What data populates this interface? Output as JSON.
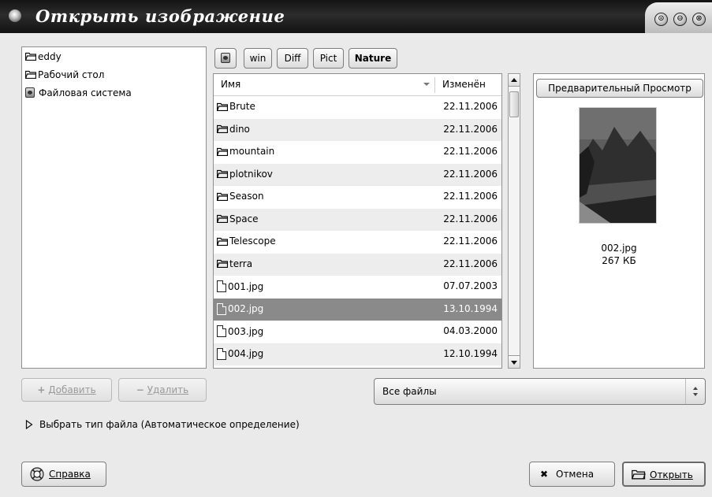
{
  "window": {
    "title": "Открыть изображение",
    "controls": [
      "⊙",
      "⊖",
      "⊗"
    ]
  },
  "places": {
    "items": [
      {
        "label": "eddy",
        "icon": "folder-icon"
      },
      {
        "label": "Рабочий стол",
        "icon": "folder-icon"
      },
      {
        "label": "Файловая система",
        "icon": "drive-icon"
      }
    ],
    "add_label": "Добавить",
    "remove_label": "Удалить"
  },
  "path_bar": {
    "segments": [
      "win",
      "Diff",
      "Pict",
      "Nature"
    ],
    "current": "Nature"
  },
  "file_list": {
    "col_name": "Имя",
    "col_modified": "Изменён",
    "rows": [
      {
        "name": "Brute",
        "date": "22.11.2006",
        "type": "folder"
      },
      {
        "name": "dino",
        "date": "22.11.2006",
        "type": "folder"
      },
      {
        "name": "mountain",
        "date": "22.11.2006",
        "type": "folder"
      },
      {
        "name": "plotnikov",
        "date": "22.11.2006",
        "type": "folder"
      },
      {
        "name": "Season",
        "date": "22.11.2006",
        "type": "folder"
      },
      {
        "name": "Space",
        "date": "22.11.2006",
        "type": "folder"
      },
      {
        "name": "Telescope",
        "date": "22.11.2006",
        "type": "folder"
      },
      {
        "name": "terra",
        "date": "22.11.2006",
        "type": "folder"
      },
      {
        "name": "001.jpg",
        "date": "07.07.2003",
        "type": "file"
      },
      {
        "name": "002.jpg",
        "date": "13.10.1994",
        "type": "file",
        "selected": true
      },
      {
        "name": "003.jpg",
        "date": "04.03.2000",
        "type": "file"
      },
      {
        "name": "004.jpg",
        "date": "12.10.1994",
        "type": "file"
      }
    ]
  },
  "preview": {
    "header": "Предварительный Просмотр",
    "file_name": "002.jpg",
    "file_size": "267 КБ"
  },
  "filter": {
    "selected": "Все файлы"
  },
  "file_type_expander": {
    "label": "Выбрать тип файла (Автоматическое определение)"
  },
  "buttons": {
    "help_label": "Справка",
    "cancel_label": "Отмена",
    "open_label": "Открыть"
  },
  "colors": {
    "titlebar": "#1c1c1c",
    "selection": "#8a8a8a",
    "background": "#eaeaea"
  }
}
